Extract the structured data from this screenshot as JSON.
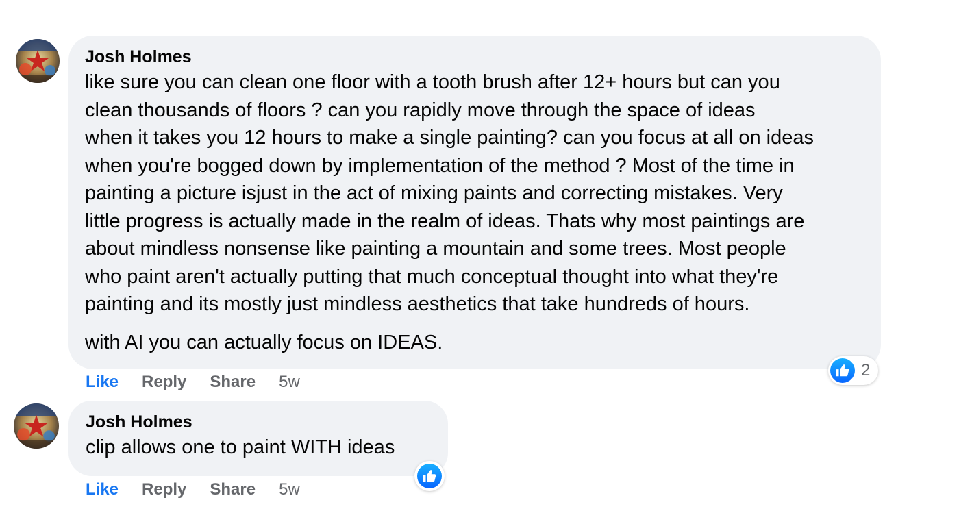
{
  "colors": {
    "bubble_bg": "#f0f2f5",
    "like_blue": "#1877f2",
    "secondary_text": "#65676b",
    "primary_text": "#050505"
  },
  "comments": [
    {
      "author": "Josh Holmes",
      "avatar_icon": "avatar-icon",
      "paragraphs": [
        "like sure you can clean one floor with a tooth brush after 12+ hours but can you",
        "clean thousands of floors ? can you rapidly move through the space of ideas",
        "when it takes you 12 hours to make a single painting? can you focus at all on ideas",
        "when you're bogged down by implementation of the method ? Most of the time in",
        "painting a picture isjust in the act of mixing paints and correcting mistakes. Very",
        "little progress is actually made in the realm of ideas. Thats why most paintings are",
        "about mindless nonsense like painting a mountain and some trees. Most people",
        "who paint aren't actually putting that much conceptual thought into what they're",
        "painting and its mostly just mindless aesthetics that take hundreds of hours."
      ],
      "second_paragraph": "with AI you can actually focus on IDEAS.",
      "actions": {
        "like": "Like",
        "reply": "Reply",
        "share": "Share",
        "time": "5w"
      },
      "reactions": {
        "icon": "thumbs-up-icon",
        "count": "2"
      }
    },
    {
      "author": "Josh Holmes",
      "avatar_icon": "avatar-icon",
      "text": "clip allows one to paint WITH ideas",
      "actions": {
        "like": "Like",
        "reply": "Reply",
        "share": "Share",
        "time": "5w"
      },
      "reactions": {
        "icon": "thumbs-up-icon"
      }
    }
  ]
}
